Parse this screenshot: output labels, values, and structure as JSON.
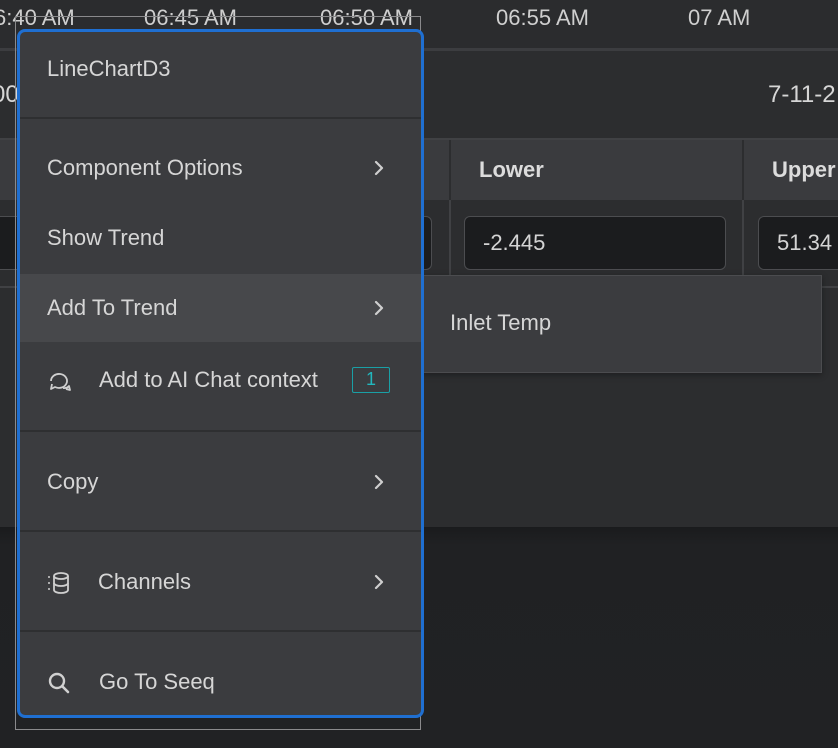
{
  "axis": {
    "ticks": [
      "6:40 AM",
      "06:45 AM",
      "06:50 AM",
      "06:55 AM",
      "07 AM"
    ]
  },
  "header_row": {
    "left_text": "00",
    "right_text": "7-11-2"
  },
  "table": {
    "columns": [
      "",
      "Lower",
      "Upper"
    ],
    "row": {
      "lower": "-2.445",
      "upper": "51.34"
    }
  },
  "context_menu": {
    "title": "LineChartD3",
    "items": [
      {
        "label": "Component Options",
        "has_submenu": true
      },
      {
        "label": "Show Trend",
        "has_submenu": false
      },
      {
        "label": "Add To Trend",
        "has_submenu": true,
        "highlighted": true
      },
      {
        "label": "Add to AI Chat context",
        "icon": "chat-icon",
        "badge": "1"
      },
      {
        "label": "Copy",
        "has_submenu": true
      },
      {
        "label": "Channels",
        "icon": "database-icon",
        "has_submenu": true
      },
      {
        "label": "Go To Seeq",
        "icon": "search-icon"
      }
    ]
  },
  "submenu": {
    "items": [
      "Inlet Temp"
    ]
  },
  "colors": {
    "focus_border": "#1f6fd1",
    "badge": "#1aa0a6",
    "menu_bg": "#3b3c3f",
    "hover_bg": "#47484b"
  }
}
